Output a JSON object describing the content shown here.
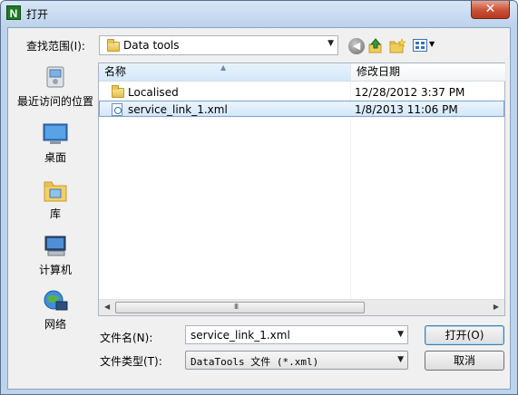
{
  "window": {
    "title": "打开",
    "app_icon_letter": "N",
    "close_glyph": "✕"
  },
  "lookin": {
    "label": "查找范围(I):",
    "value": "Data tools"
  },
  "toolbar": {
    "icons": [
      "back-icon",
      "up-folder-icon",
      "new-folder-icon",
      "view-menu-icon"
    ]
  },
  "places": [
    {
      "label": "最近访问的位置",
      "icon": "recent-places-icon"
    },
    {
      "label": "桌面",
      "icon": "desktop-icon"
    },
    {
      "label": "库",
      "icon": "library-icon"
    },
    {
      "label": "计算机",
      "icon": "computer-icon"
    },
    {
      "label": "网络",
      "icon": "network-icon"
    }
  ],
  "filelist": {
    "columns": [
      "名称",
      "修改日期"
    ],
    "rows": [
      {
        "name": "Localised",
        "modified": "12/28/2012 3:37 PM",
        "type": "folder",
        "selected": false
      },
      {
        "name": "service_link_1.xml",
        "modified": "1/8/2013 11:06 PM",
        "type": "xml",
        "selected": true
      }
    ],
    "scroll_grip": "III"
  },
  "filename": {
    "label": "文件名(N):",
    "value": "service_link_1.xml"
  },
  "filetype": {
    "label": "文件类型(T):",
    "value": "DataTools 文件 (*.xml)"
  },
  "buttons": {
    "open": "打开(O)",
    "cancel": "取消"
  }
}
